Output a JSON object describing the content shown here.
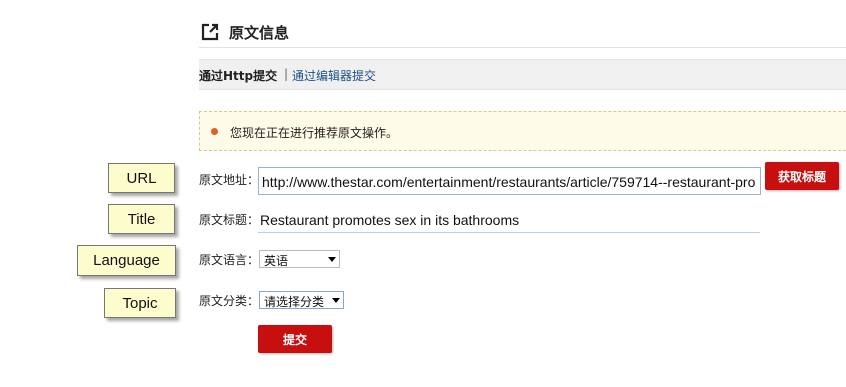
{
  "header": {
    "title": "原文信息",
    "icon": "external-link-icon"
  },
  "tabs": {
    "active": "通过Http提交",
    "separator": "|",
    "link": "通过编辑器提交"
  },
  "notice": {
    "text": "您现在正在进行推荐原文操作。"
  },
  "annotations": {
    "url": "URL",
    "title": "Title",
    "language": "Language",
    "topic": "Topic"
  },
  "form": {
    "url_label": "原文地址：",
    "url_value": "http://www.thestar.com/entertainment/restaurants/article/759714--restaurant-pro",
    "fetch_button": "获取标题",
    "title_label": "原文标题：",
    "title_value": "Restaurant promotes sex in its bathrooms",
    "language_label": "原文语言：",
    "language_value": "英语",
    "topic_label": "原文分类：",
    "topic_value": "请选择分类",
    "submit_button": "提交"
  },
  "colors": {
    "accent_red": "#c80f0f",
    "link_blue": "#1a4f8a",
    "notice_bg": "#fefbe8",
    "tag_bg": "#fdfccd"
  }
}
